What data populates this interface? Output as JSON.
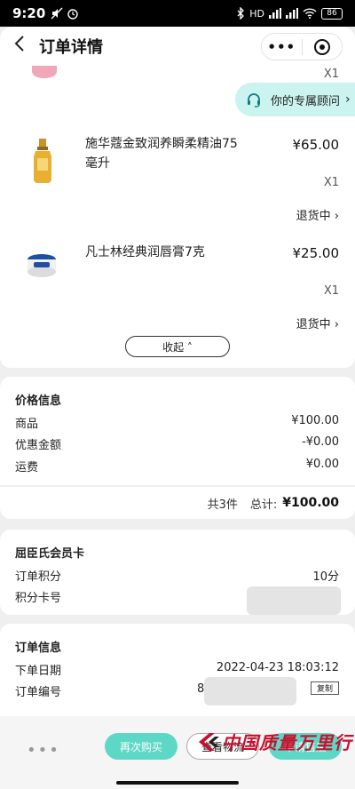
{
  "status_bar": {
    "time": "9:20",
    "network_label": "HD",
    "battery": "86"
  },
  "header": {
    "title": "订单详情",
    "more": "•••"
  },
  "advisor": {
    "label": "你的专属顾问",
    "arrow": "›"
  },
  "products": [
    {
      "qty": "X1"
    },
    {
      "name": "施华蔻金致润养瞬柔精油75毫升",
      "price": "¥65.00",
      "qty": "X1",
      "status": "退货中 ›"
    },
    {
      "name": "凡士林经典润唇膏7克",
      "price": "¥25.00",
      "qty": "X1",
      "status": "退货中 ›"
    }
  ],
  "collapse_label": "收起 ˄",
  "price_info": {
    "title": "价格信息",
    "rows": [
      {
        "label": "商品",
        "value": "¥100.00"
      },
      {
        "label": "优惠金额",
        "value": "-¥0.00"
      },
      {
        "label": "运费",
        "value": "¥0.00"
      }
    ]
  },
  "total": {
    "count": "共3件",
    "label": "总计:",
    "amount": "¥100.00"
  },
  "member": {
    "title": "屈臣氏会员卡",
    "points_label": "订单积分",
    "points_value": "10分",
    "card_label": "积分卡号"
  },
  "order_info": {
    "title": "订单信息",
    "date_label": "下单日期",
    "date_value": "2022-04-23 18:03:12",
    "number_label": "订单编号",
    "number_value": "8",
    "copy_label": "复制"
  },
  "bottom": {
    "more": "•••",
    "rebuy": "再次购买",
    "logistics": "查看物流",
    "aftersale": "申请售后"
  },
  "watermark": "中国质量万里行",
  "colors": {
    "accent": "#5ed8c6",
    "advisor_bg": "#cbf3ef",
    "watermark": "#c8102e"
  }
}
